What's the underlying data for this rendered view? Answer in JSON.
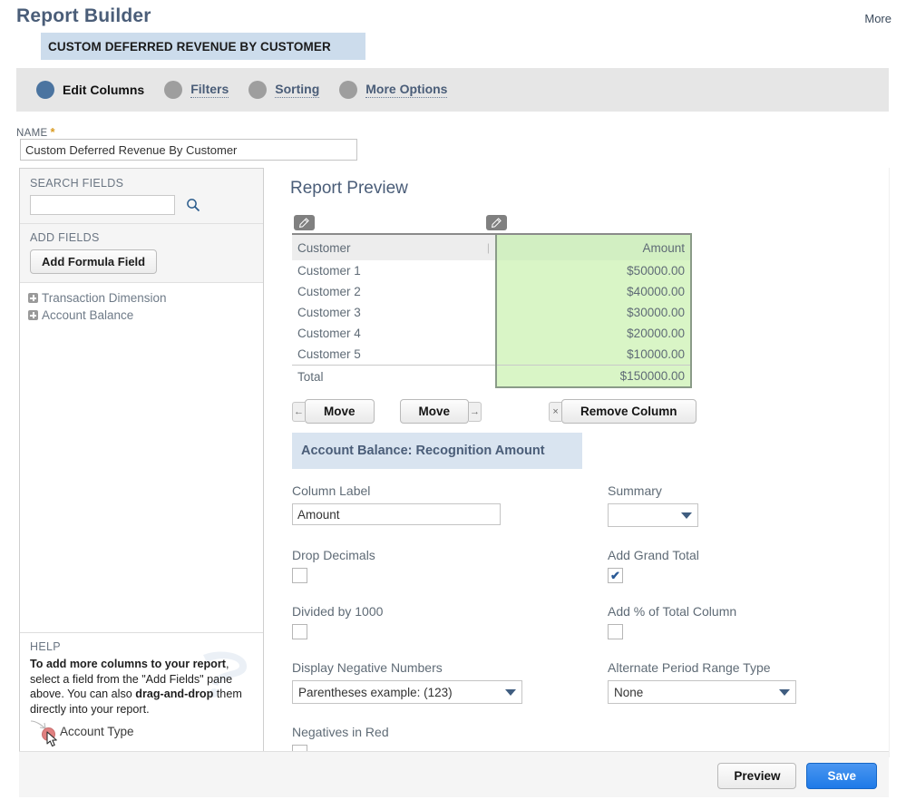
{
  "header": {
    "title": "Report Builder",
    "more_label": "More",
    "report_banner": "CUSTOM DEFERRED REVENUE BY CUSTOMER"
  },
  "tabs": [
    {
      "label": "Edit Columns",
      "active": true
    },
    {
      "label": "Filters",
      "active": false
    },
    {
      "label": "Sorting",
      "active": false
    },
    {
      "label": "More Options",
      "active": false
    }
  ],
  "name_field": {
    "label": "NAME",
    "required_marker": "*",
    "value": "Custom Deferred Revenue By Customer"
  },
  "sidebar": {
    "search_label": "SEARCH FIELDS",
    "search_value": "",
    "search_placeholder": "",
    "add_fields_label": "ADD FIELDS",
    "add_formula_label": "Add Formula Field",
    "tree_items": [
      {
        "label": "Transaction Dimension"
      },
      {
        "label": "Account Balance"
      }
    ],
    "help_label": "HELP",
    "help_strong_1": "To add more columns to your report",
    "help_mid_1": ", select a field from the \"Add Fields\" pane above. You can also ",
    "help_strong_2": "drag-and-drop",
    "help_mid_2": " them directly into your report.",
    "drag_demo_label": "Account Type"
  },
  "main": {
    "preview_heading": "Report Preview",
    "edit_icons": [
      {
        "name": "edit-column-customer"
      },
      {
        "name": "edit-column-amount"
      }
    ],
    "buttons": {
      "move_left_label": "Move",
      "move_right_label": "Move",
      "remove_column_label": "Remove Column",
      "move_left_arrow": "←",
      "move_right_arrow": "→",
      "remove_x": "×"
    },
    "column_settings": {
      "title": "Account Balance: Recognition Amount",
      "column_label_label": "Column Label",
      "column_label_value": "Amount",
      "summary_label": "Summary",
      "summary_value": "",
      "drop_decimals_label": "Drop Decimals",
      "drop_decimals_checked": false,
      "add_grand_total_label": "Add Grand Total",
      "add_grand_total_checked": true,
      "divided_by_1000_label": "Divided by 1000",
      "divided_by_1000_checked": false,
      "add_pct_of_total_label": "Add % of Total Column",
      "add_pct_of_total_checked": false,
      "display_negative_label": "Display Negative Numbers",
      "display_negative_value": "Parentheses  example: (123)",
      "alternate_period_label": "Alternate Period Range Type",
      "alternate_period_value": "None",
      "negatives_in_red_label": "Negatives in Red",
      "negatives_in_red_checked": false,
      "check_glyph": "✔"
    }
  },
  "chart_data": {
    "type": "table",
    "title": "Report Preview",
    "columns": [
      "Customer",
      "Amount"
    ],
    "selected_column": "Amount",
    "rows": [
      {
        "customer": "Customer 1",
        "amount": "$50000.00"
      },
      {
        "customer": "Customer 2",
        "amount": "$40000.00"
      },
      {
        "customer": "Customer 3",
        "amount": "$30000.00"
      },
      {
        "customer": "Customer 4",
        "amount": "$20000.00"
      },
      {
        "customer": "Customer 5",
        "amount": "$10000.00"
      }
    ],
    "total_label": "Total",
    "total_amount": "$150000.00",
    "values": [
      50000,
      40000,
      30000,
      20000,
      10000
    ],
    "categories": [
      "Customer 1",
      "Customer 2",
      "Customer 3",
      "Customer 4",
      "Customer 5"
    ],
    "total": 150000
  },
  "footer": {
    "preview_label": "Preview",
    "save_label": "Save"
  },
  "colors": {
    "accent_blue": "#4b74a0",
    "save_blue": "#1e7ae8",
    "banner_blue": "#ccdcec",
    "selected_green": "#d9f5c6",
    "tabbar_gray": "#e6e6e6",
    "required_orange": "#d99b22"
  }
}
